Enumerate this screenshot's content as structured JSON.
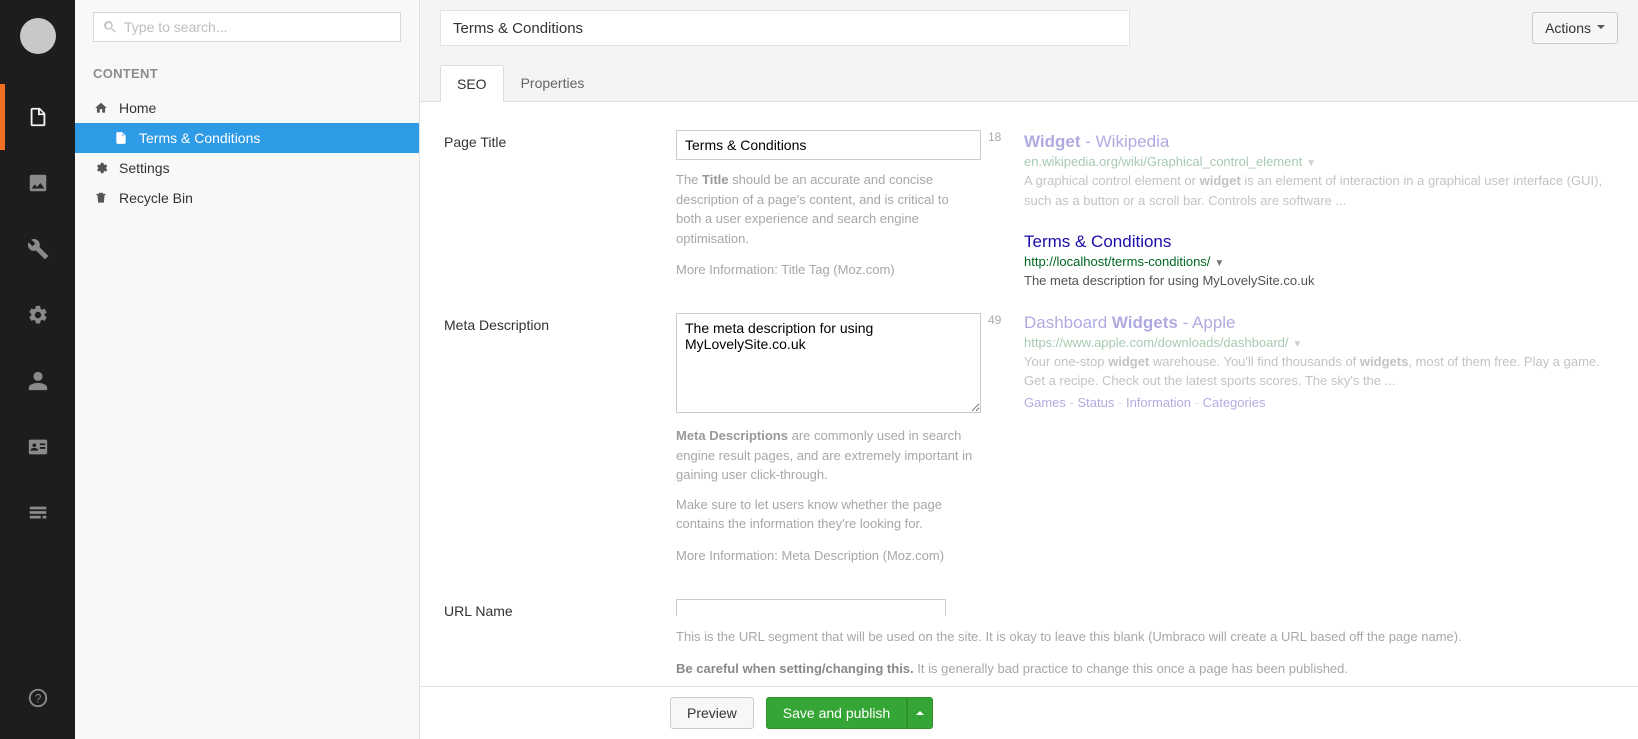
{
  "search": {
    "placeholder": "Type to search..."
  },
  "section_label": "CONTENT",
  "tree": {
    "home": "Home",
    "terms": "Terms & Conditions",
    "settings": "Settings",
    "recycle": "Recycle Bin"
  },
  "header": {
    "title": "Terms & Conditions",
    "actions": "Actions"
  },
  "tabs": {
    "seo": "SEO",
    "properties": "Properties"
  },
  "fields": {
    "page_title": {
      "label": "Page Title",
      "value": "Terms & Conditions",
      "count": "18",
      "help_pre": "The ",
      "help_bold": "Title",
      "help_post": " should be an accurate and concise description of a page's content, and is critical to both a user experience and search engine optimisation.",
      "more_label": "More Information: ",
      "more_link": "Title Tag (Moz.com)"
    },
    "meta_description": {
      "label": "Meta Description",
      "value": "The meta description for using MyLovelySite.co.uk",
      "count": "49",
      "help_bold": "Meta Descriptions",
      "help_post": " are commonly used in search engine result pages, and are extremely important in gaining user click-through.",
      "help2": "Make sure to let users know whether the page contains the information they're looking for.",
      "more_label": "More Information: ",
      "more_link": "Meta Description (Moz.com)"
    },
    "url_name": {
      "label": "URL Name",
      "value": "",
      "help1": "This is the URL segment that will be used on the site. It is okay to leave this blank (Umbraco will create a URL based off the page name).",
      "help2_bold": "Be careful when setting/changing this.",
      "help2_post": " It is generally bad practice to change this once a page has been published."
    }
  },
  "serp": {
    "item1": {
      "title_a": "Widget",
      "title_sep": " - ",
      "title_b": "Wikipedia",
      "url": "en.wikipedia.org/wiki/Graphical_control_element",
      "desc_a": "A graphical control element or ",
      "desc_b": "widget",
      "desc_c": " is an element of interaction in a graphical user interface (GUI), such as a button or a scroll bar. Controls are software ..."
    },
    "item2": {
      "title": "Terms & Conditions",
      "url": "http://localhost/terms-conditions/",
      "desc": "The meta description for using MyLovelySite.co.uk"
    },
    "item3": {
      "title_a": "Dashboard ",
      "title_b": "Widgets",
      "title_sep": " - ",
      "title_c": "Apple",
      "url": "https://www.apple.com/downloads/dashboard/",
      "desc_a": "Your one-stop ",
      "desc_b": "widget",
      "desc_c": " warehouse. You'll find thousands of ",
      "desc_d": "widgets",
      "desc_e": ", most of them free. Play a game. Get a recipe. Check out the latest sports scores. The sky's the ...",
      "links": {
        "a": "Games",
        "b": "Status",
        "c": "Information",
        "d": "Categories"
      }
    }
  },
  "footer": {
    "preview": "Preview",
    "save": "Save and publish"
  }
}
